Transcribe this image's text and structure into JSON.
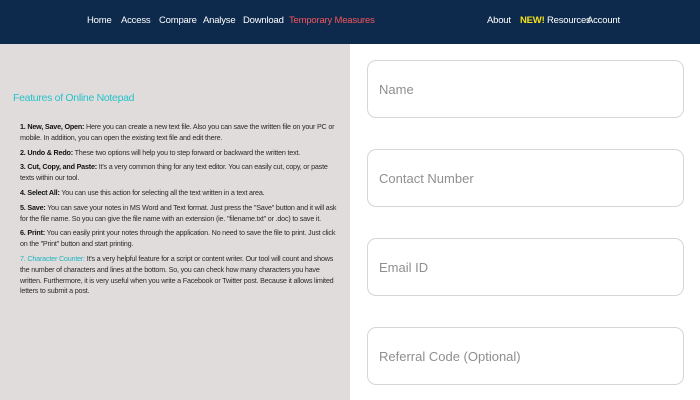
{
  "nav": {
    "home": "Home",
    "access": "Access",
    "compare": "Compare",
    "analyse": "Analyse",
    "download": "Download",
    "temporary_measures": "Temporary Measures",
    "about": "About",
    "new_badge": "NEW!",
    "resources": "Resources",
    "account": "Account"
  },
  "features": {
    "title": "Features of Online Notepad",
    "items": [
      {
        "label": "1. New, Save, Open:",
        "text": " Here you can create a new text file. Also you can save the written file on your PC or mobile. In addition, you can open the existing text file and edit there."
      },
      {
        "label": "2. Undo & Redo:",
        "text": " These two options will help you to step forward or backward the written text."
      },
      {
        "label": "3. Cut, Copy, and Paste:",
        "text": " It's a very common thing for any text editor. You can easily cut, copy, or paste texts within our tool."
      },
      {
        "label": "4. Select All:",
        "text": " You can use this action for selecting all the text written in a text area."
      },
      {
        "label": "5. Save:",
        "text": " You can save your notes in MS Word and Text format. Just press the \"Save\" button and it will ask for the file name. So you can give the file name with an extension (ie. \"filename.txt\" or .doc) to save it."
      },
      {
        "label": "6. Print:",
        "text": " You can easily print your notes through the application. No need to save the file to print. Just click on the \"Print\" button and start printing."
      },
      {
        "label": "7. Character Counter:",
        "text": " It's a very helpful feature for a script or content writer. Our tool will count and shows the number of characters and lines at the bottom. So, you can check how many characters you have written. Furthermore, it is very useful when you write a Facebook or Twitter post. Because it allows limited letters to submit a post."
      }
    ]
  },
  "form": {
    "name_placeholder": "Name",
    "contact_placeholder": "Contact Number",
    "email_placeholder": "Email ID",
    "referral_placeholder": "Referral Code (Optional)"
  },
  "colors": {
    "nav_bg": "#0d2a4c",
    "nav_active": "#f2545b",
    "new_badge": "#f5e11a",
    "left_bg": "#e0dcdc",
    "title_teal": "#27c2c7"
  }
}
